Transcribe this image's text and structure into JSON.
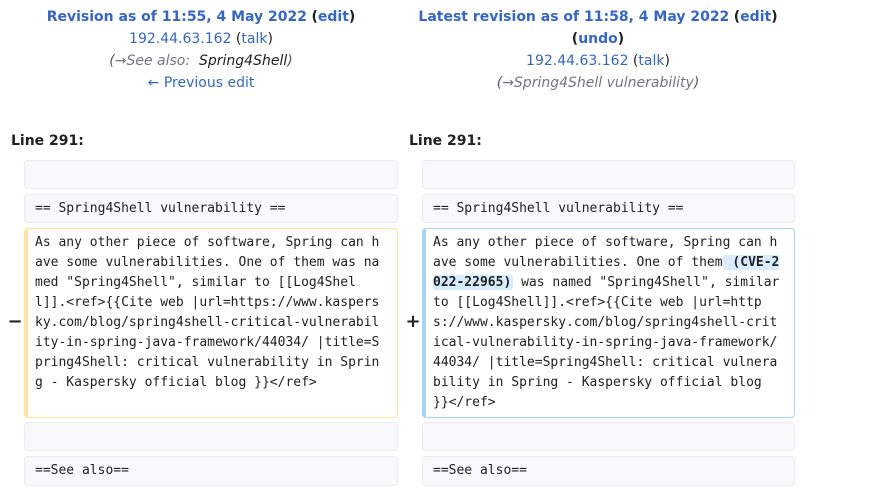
{
  "left": {
    "title": "Revision as of 11:55, 4 May 2022",
    "edit_label": "edit",
    "ip": "192.44.63.162",
    "talk_label": "talk",
    "summary_arrow": "→See also:",
    "summary_text": "Spring4Shell",
    "prev_edit": "← Previous edit",
    "line_label": "Line 291:"
  },
  "right": {
    "title": "Latest revision as of 11:58, 4 May 2022",
    "edit_label": "edit",
    "undo_label": "undo",
    "ip": "192.44.63.162",
    "talk_label": "talk",
    "summary_arrow": "→Spring4Shell vulnerability",
    "line_label": "Line 291:"
  },
  "diff": {
    "context_heading": "== Spring4Shell vulnerability ==",
    "left_changed": "As any other piece of software, Spring can have some vulnerabilities. One of them was named \"Spring4Shell\", similar to [[Log4Shell]].<ref>{{Cite web |url=https://www.kaspersky.com/blog/spring4shell-critical-vulnerability-in-spring-java-framework/44034/ |title=Spring4Shell: critical vulnerability in Spring - Kaspersky official blog }}</ref>",
    "right_changed_pre": "As any other piece of software, Spring can have some vulnerabilities. One of them",
    "right_changed_inserted": " (CVE-2022-22965)",
    "right_changed_post": " was named \"Spring4Shell\", similar to [[Log4Shell]].<ref>{{Cite web |url=https://www.kaspersky.com/blog/spring4shell-critical-vulnerability-in-spring-java-framework/44034/ |title=Spring4Shell: critical vulnerability in Spring - Kaspersky official blog }}</ref>",
    "context_see_also": "==See also==",
    "minus_marker": "−",
    "plus_marker": "+"
  }
}
